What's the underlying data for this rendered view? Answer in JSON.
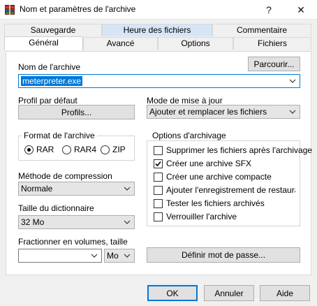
{
  "window": {
    "title": "Nom et paramètres de l'archive",
    "help_btn": "?",
    "close_btn": "✕"
  },
  "tabs_back": [
    "Sauvegarde",
    "Heure des fichiers",
    "Commentaire"
  ],
  "tabs_front": [
    "Général",
    "Avancé",
    "Options",
    "Fichiers"
  ],
  "archive_name": {
    "label": "Nom de l'archive",
    "browse_button": "Parcourir...",
    "value": "meterpreter.exe"
  },
  "default_profile": {
    "label": "Profil par défaut",
    "button": "Profils..."
  },
  "update_mode": {
    "label": "Mode de mise à jour",
    "value": "Ajouter et remplacer les fichiers"
  },
  "archive_format": {
    "title": "Format de l'archive",
    "options": [
      "RAR",
      "RAR4",
      "ZIP"
    ],
    "selected": "RAR"
  },
  "archive_options": {
    "title": "Options d'archivage",
    "items": [
      {
        "label": "Supprimer les fichiers après l'archivage",
        "checked": false
      },
      {
        "label": "Créer une archive SFX",
        "checked": true
      },
      {
        "label": "Créer une archive compacte",
        "checked": false
      },
      {
        "label": "Ajouter l'enregistrement de restauration",
        "checked": false
      },
      {
        "label": "Tester les fichiers archivés",
        "checked": false
      },
      {
        "label": "Verrouiller l'archive",
        "checked": false
      }
    ]
  },
  "compression": {
    "label": "Méthode de compression",
    "value": "Normale"
  },
  "dictionary": {
    "label": "Taille du dictionnaire",
    "value": "32 Mo"
  },
  "volumes": {
    "label": "Fractionner en volumes, taille",
    "value": "",
    "unit": "Mo"
  },
  "password_button": "Définir mot de passe...",
  "footer": {
    "ok": "OK",
    "cancel": "Annuler",
    "help": "Aide"
  },
  "colors": {
    "accent": "#0078d7",
    "selected_tab_header": "#d6e6f7"
  }
}
